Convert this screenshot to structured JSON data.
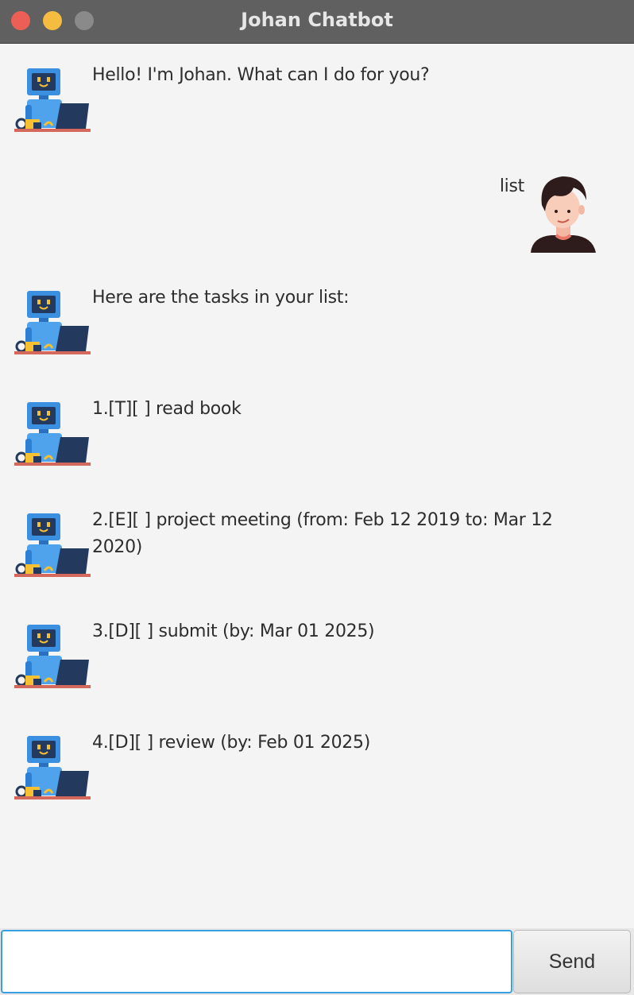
{
  "window": {
    "title": "Johan Chatbot"
  },
  "messages": [
    {
      "sender": "bot",
      "text": "Hello! I'm Johan. What can I do for you?"
    },
    {
      "sender": "user",
      "text": "list"
    },
    {
      "sender": "bot",
      "text": "Here are the tasks in your list:"
    },
    {
      "sender": "bot",
      "text": "1.[T][ ] read book"
    },
    {
      "sender": "bot",
      "text": "2.[E][ ] project meeting (from: Feb 12 2019 to: Mar 12 2020)"
    },
    {
      "sender": "bot",
      "text": "3.[D][ ] submit (by: Mar 01 2025)"
    },
    {
      "sender": "bot",
      "text": "4.[D][ ] review (by: Feb 01 2025)"
    }
  ],
  "input": {
    "value": "",
    "placeholder": ""
  },
  "send_label": "Send",
  "colors": {
    "input_focus_border": "#3a9fe0",
    "titlebar": "#606060",
    "background": "#f4f4f4"
  }
}
